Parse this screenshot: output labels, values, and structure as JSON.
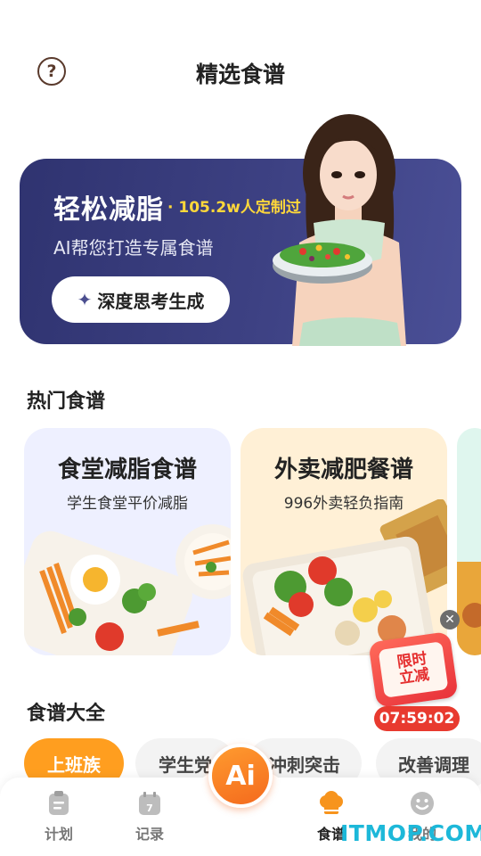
{
  "header": {
    "title": "精选食谱",
    "help_icon": "question-circle-icon"
  },
  "banner": {
    "title": "轻松减脂",
    "stat": "· 105.2w人定制过",
    "subtitle": "AI帮您打造专属食谱",
    "button_label": "深度思考生成",
    "colors": {
      "background": "#3a3e7f",
      "accent": "#ffd83a"
    }
  },
  "hot_section": {
    "title": "热门食谱",
    "cards": [
      {
        "title": "食堂减脂食谱",
        "subtitle": "学生食堂平价减脂",
        "bg": "#eef0ff"
      },
      {
        "title": "外卖减肥餐谱",
        "subtitle": "996外卖轻负指南",
        "bg": "#fff0d6"
      },
      {
        "title": "",
        "subtitle": "",
        "bg": "#dff6ee"
      }
    ]
  },
  "all_section": {
    "title": "食谱大全",
    "chips": [
      "上班族",
      "学生党",
      "冲刺突击",
      "改善调理"
    ],
    "active_chip": "上班族"
  },
  "promo": {
    "label_line1": "限时",
    "label_line2": "立减",
    "timer": "07:59:02"
  },
  "tabbar": {
    "items": [
      {
        "label": "计划",
        "icon": "clipboard-icon"
      },
      {
        "label": "记录",
        "icon": "calendar-icon"
      },
      {
        "label": "食谱",
        "icon": "chef-hat-icon",
        "active": true
      },
      {
        "label": "我的",
        "icon": "smiley-icon"
      }
    ],
    "ai_label": "Ai"
  },
  "watermark": "ITMOP.COM"
}
